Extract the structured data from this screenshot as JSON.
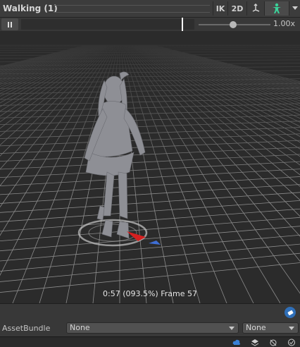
{
  "window": {
    "title": "Walking (1)"
  },
  "toolbar": {
    "ik_label": "IK",
    "two_d_label": "2D",
    "axis_icon": "pivot-axis-icon",
    "avatar_icon": "humanoid-avatar-icon",
    "menu_icon": "chevron-down-icon"
  },
  "playback": {
    "pause_icon": "pause-icon",
    "timeline_progress": 0.935,
    "speed_slider_fraction": 0.48,
    "speed_label": "1.00x"
  },
  "viewport": {
    "frame_info": "0:57 (093.5%) Frame 57",
    "figure": "humanoid-character-model",
    "gizmo_colors": {
      "forward": "#d42020",
      "side": "#3f6fd6"
    }
  },
  "assetbundle": {
    "label": "AssetBundle",
    "name_value": "None",
    "variant_value": "None",
    "tag_icon": "asset-label-tag-icon"
  },
  "statusbar": {
    "icons": [
      "collab-cloud-icon",
      "layers-icon",
      "debug-icon",
      "check-circle-icon"
    ]
  },
  "colors": {
    "accent_blue": "#2f6fb8",
    "avatar_green": "#3bd39a"
  }
}
